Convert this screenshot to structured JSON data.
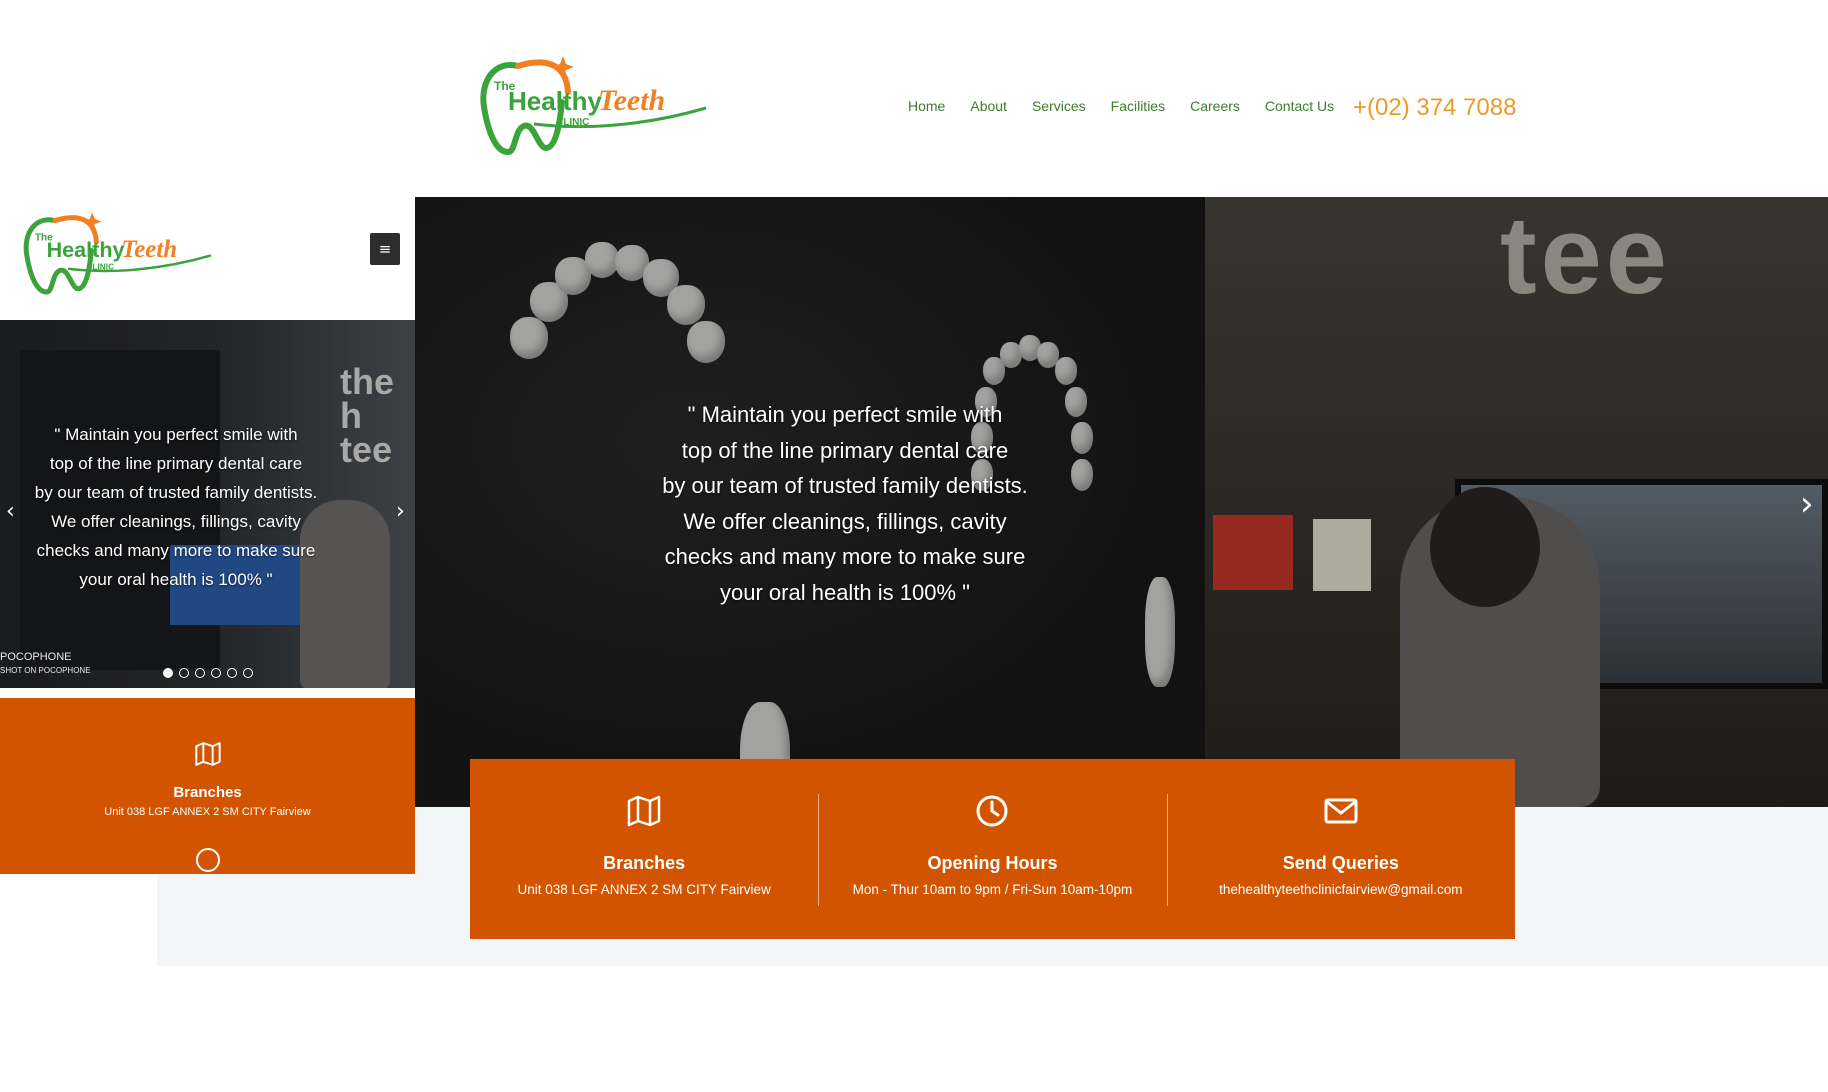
{
  "brand": {
    "logo_small_text": "The",
    "logo_main_a": "Healthy",
    "logo_main_b": "Teeth",
    "logo_sub": "CLINIC",
    "colors": {
      "green": "#3aa33b",
      "orange": "#f08021",
      "accent": "#d35400",
      "nav_text": "#3e7d2e",
      "phone": "#ee9a2a"
    }
  },
  "nav": {
    "items": [
      "Home",
      "About",
      "Services",
      "Facilities",
      "Careers",
      "Contact Us"
    ],
    "phone": "+(02) 374 7088"
  },
  "hero": {
    "quote_lines": [
      "\" Maintain you perfect smile with",
      "top of the line primary dental care",
      "by our team of trusted family dentists.",
      "We offer cleanings, fillings, cavity",
      "checks and many more to make sure",
      "your oral health is 100% \""
    ],
    "wall_text": "tee",
    "prev_icon": "chevron-left-icon",
    "next_icon": "chevron-right-icon"
  },
  "info": [
    {
      "icon": "map-icon",
      "title": "Branches",
      "text": "Unit 038 LGF ANNEX 2 SM CITY Fairview"
    },
    {
      "icon": "clock-icon",
      "title": "Opening Hours",
      "text": "Mon - Thur 10am to 9pm / Fri-Sun 10am-10pm"
    },
    {
      "icon": "envelope-icon",
      "title": "Send Queries",
      "text": "thehealthyteethclinicfairview@gmail.com"
    }
  ],
  "mobile": {
    "menu_icon": "≡",
    "wall_text_1": "the h",
    "wall_text_2": "tee",
    "caption_1": "POCOPHONE",
    "caption_2": "SHOT ON POCOPHONE",
    "slide_count": 6,
    "active_slide": 1,
    "info_title": "Branches",
    "info_text": "Unit 038 LGF ANNEX 2 SM CITY Fairview"
  }
}
